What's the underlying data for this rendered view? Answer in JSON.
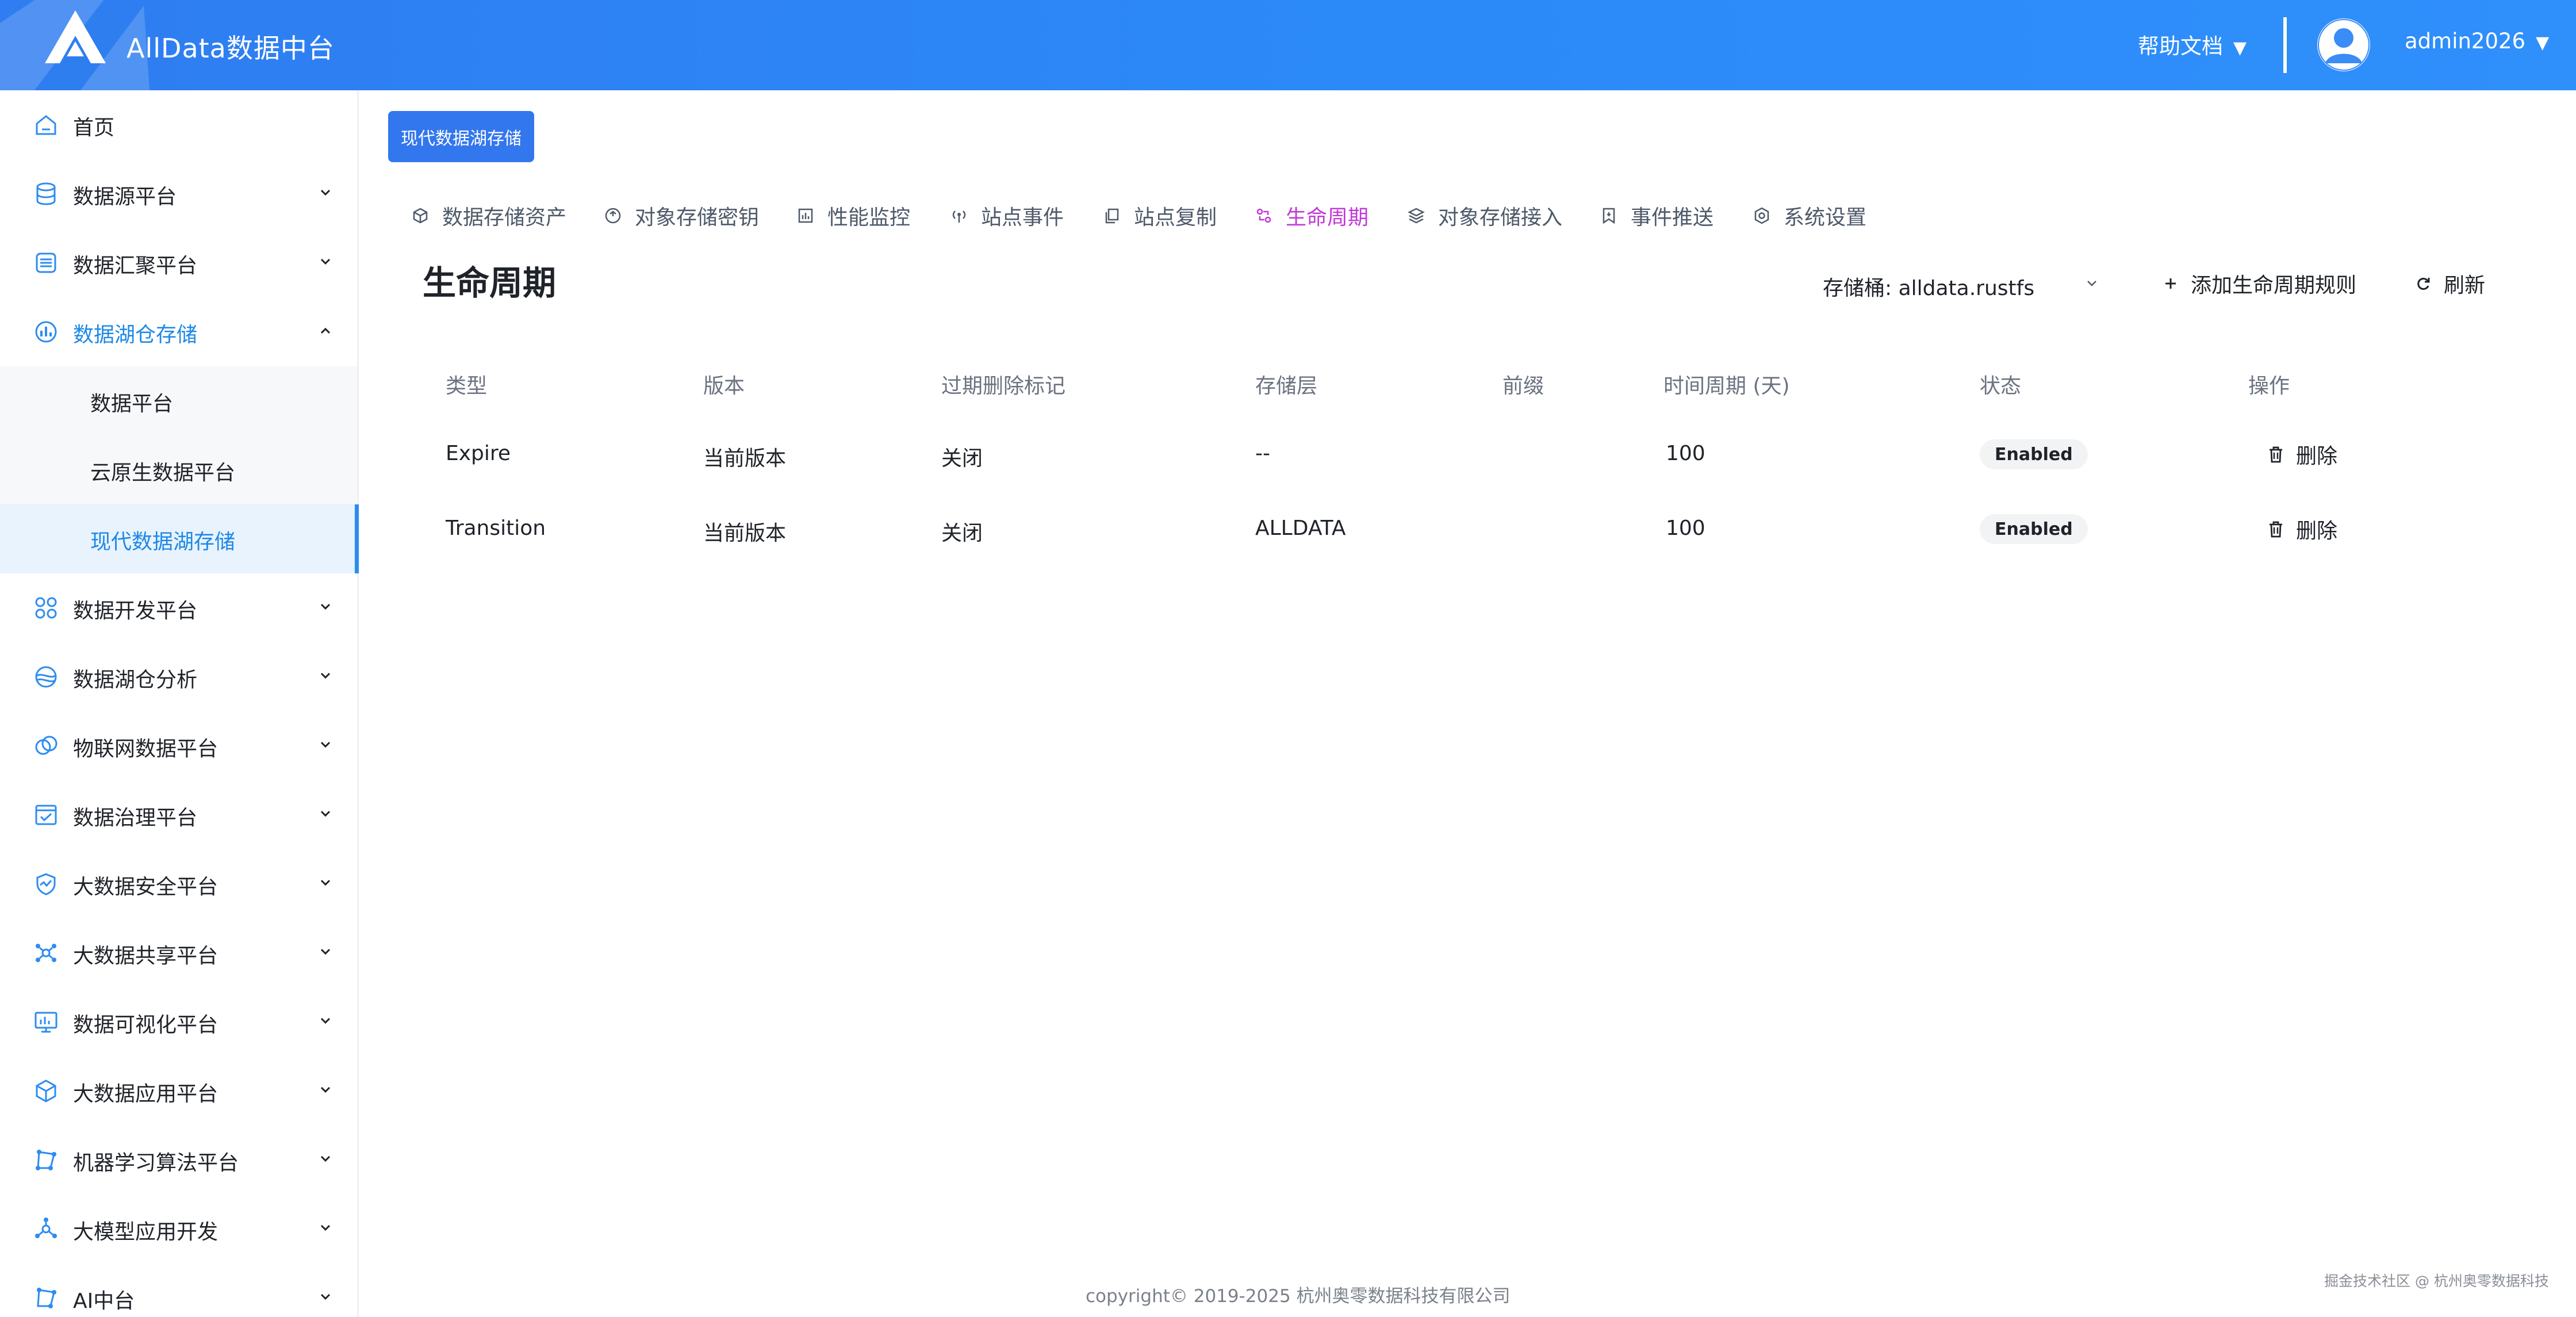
{
  "header": {
    "app_title": "AllData数据中台",
    "help_label": "帮助文档",
    "user_name": "admin2026",
    "caret": "▼"
  },
  "sidebar": {
    "items": [
      {
        "label": "首页",
        "icon": "home-icon"
      },
      {
        "label": "数据源平台",
        "icon": "database-icon"
      },
      {
        "label": "数据汇聚平台",
        "icon": "database-stack-icon"
      },
      {
        "label": "数据湖仓存储",
        "icon": "lakehouse-icon",
        "expanded": true,
        "children": [
          {
            "label": "数据平台"
          },
          {
            "label": "云原生数据平台"
          },
          {
            "label": "现代数据湖存储",
            "selected": true
          }
        ]
      },
      {
        "label": "数据开发平台",
        "icon": "grid-icon"
      },
      {
        "label": "数据湖仓分析",
        "icon": "lake-analysis-icon"
      },
      {
        "label": "物联网数据平台",
        "icon": "iot-icon"
      },
      {
        "label": "数据治理平台",
        "icon": "governance-icon"
      },
      {
        "label": "大数据安全平台",
        "icon": "shield-icon"
      },
      {
        "label": "大数据共享平台",
        "icon": "share-icon"
      },
      {
        "label": "数据可视化平台",
        "icon": "monitor-icon"
      },
      {
        "label": "大数据应用平台",
        "icon": "cube-icon"
      },
      {
        "label": "机器学习算法平台",
        "icon": "ml-icon"
      },
      {
        "label": "大模型应用开发",
        "icon": "llm-icon"
      },
      {
        "label": "AI中台",
        "icon": "ai-icon"
      }
    ]
  },
  "breadcrumb": {
    "label": "现代数据湖存储"
  },
  "tabs": [
    {
      "label": "数据存储资产",
      "icon": "cube-outline-icon"
    },
    {
      "label": "对象存储密钥",
      "icon": "key-circle-icon"
    },
    {
      "label": "性能监控",
      "icon": "chart-box-icon"
    },
    {
      "label": "站点事件",
      "icon": "broadcast-icon"
    },
    {
      "label": "站点复制",
      "icon": "copy-icon"
    },
    {
      "label": "生命周期",
      "icon": "lifecycle-icon",
      "active": true
    },
    {
      "label": "对象存储接入",
      "icon": "layers-icon"
    },
    {
      "label": "事件推送",
      "icon": "bookmark-icon"
    },
    {
      "label": "系统设置",
      "icon": "settings-icon"
    }
  ],
  "page": {
    "title": "生命周期",
    "bucket_label": "存储桶: alldata.rustfs",
    "add_rule_label": "添加生命周期规则",
    "refresh_label": "刷新"
  },
  "table": {
    "columns": [
      "类型",
      "版本",
      "过期删除标记",
      "存储层",
      "前缀",
      "时间周期 (天)",
      "状态",
      "操作"
    ],
    "rows": [
      {
        "type": "Expire",
        "version": "当前版本",
        "delete_marker": "关闭",
        "tier": "--",
        "prefix": "",
        "days": "100",
        "status": "Enabled",
        "action": "删除"
      },
      {
        "type": "Transition",
        "version": "当前版本",
        "delete_marker": "关闭",
        "tier": "ALLDATA",
        "prefix": "",
        "days": "100",
        "status": "Enabled",
        "action": "删除"
      }
    ]
  },
  "footer": {
    "copyright": "copyright© 2019-2025 杭州奥零数据科技有限公司"
  },
  "watermark": "掘金技术社区 @ 杭州奥零数据科技",
  "colors": {
    "header_blue": "#2c8af8",
    "accent_blue": "#1e88e5",
    "active_tab": "#c03ad6",
    "breadcrumb_bg": "#3377ee"
  }
}
